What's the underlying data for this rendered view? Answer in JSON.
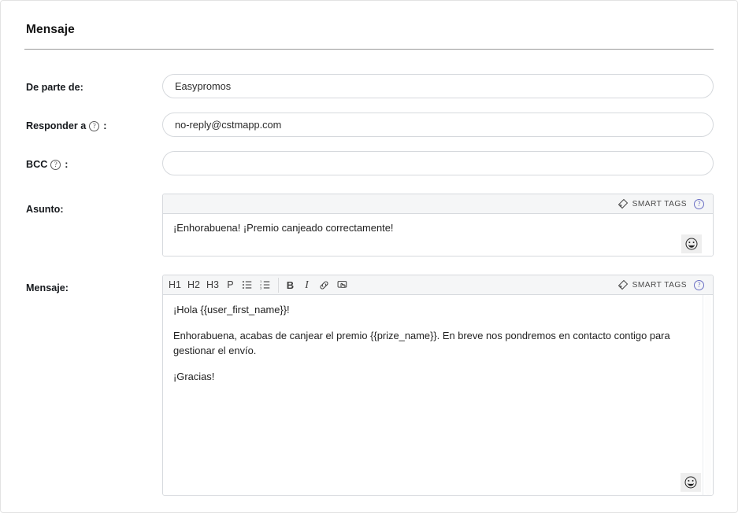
{
  "section": {
    "title": "Mensaje"
  },
  "fields": {
    "from": {
      "label": "De parte de:",
      "value": "Easypromos",
      "placeholder": ""
    },
    "reply_to": {
      "label": "Responder a",
      "colon": ":",
      "help_icon": "help-circle-icon",
      "value": "no-reply@cstmapp.com",
      "placeholder": ""
    },
    "bcc": {
      "label": "BCC",
      "colon": ":",
      "help_icon": "help-circle-icon",
      "value": "",
      "placeholder": ""
    },
    "subject": {
      "label": "Asunto:",
      "value": "¡Enhorabuena! ¡Premio canjeado correctamente!"
    },
    "message": {
      "label": "Mensaje:",
      "paragraphs": [
        "¡Hola {{user_first_name}}!",
        "Enhorabuena, acabas de canjear el premio {{prize_name}}. En breve nos pondremos en contacto contigo para gestionar el envío.",
        "¡Gracias!"
      ]
    }
  },
  "smart_tags": {
    "label": "SMART TAGS",
    "tag_icon": "tag-icon",
    "help_icon": "help-circle-icon"
  },
  "toolbar": {
    "h1": "H1",
    "h2": "H2",
    "h3": "H3",
    "p": "P",
    "bullet_list_icon": "bullet-list-icon",
    "numbered_list_icon": "numbered-list-icon",
    "bold": "B",
    "italic": "I",
    "link_icon": "link-icon",
    "button_icon": "insert-button-icon"
  },
  "emoji": {
    "icon": "smiley-emoji-icon"
  },
  "colors": {
    "accent_purple": "#6a6fc4",
    "border": "#d6d9dd",
    "toolbar_bg": "#f5f6f7",
    "text": "#1f1f1f"
  }
}
